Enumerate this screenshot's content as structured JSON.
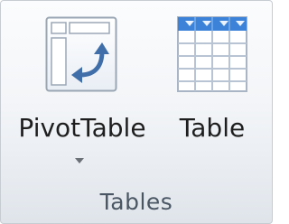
{
  "group": {
    "label": "Tables"
  },
  "commands": {
    "pivot_table": {
      "label": "PivotTable",
      "icon": "pivot-table-icon",
      "has_dropdown": true
    },
    "table": {
      "label": "Table",
      "icon": "table-icon"
    }
  },
  "colors": {
    "header_blue": "#3c82d8",
    "grid_line": "#b8c4d3",
    "arrow_blue": "#3f6ea8",
    "group_label": "#4a5663"
  }
}
